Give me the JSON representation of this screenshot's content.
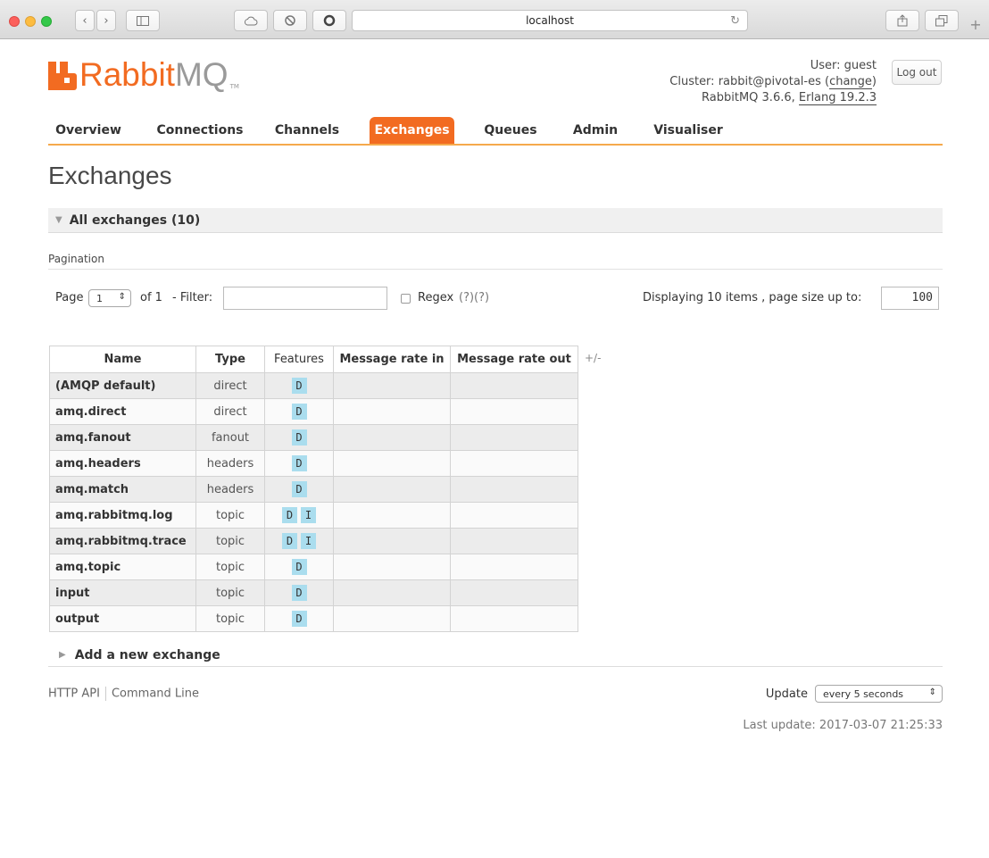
{
  "browser": {
    "address": "localhost",
    "reload_glyph": "↻",
    "newtab_glyph": "+"
  },
  "header": {
    "logo_rabbit": "Rabbit",
    "logo_mq": "MQ",
    "logo_tm": "TM",
    "user_line": "User: guest",
    "cluster_prefix": "Cluster: rabbit@pivotal-es (",
    "cluster_change": "change",
    "cluster_suffix": ")",
    "version_prefix": "RabbitMQ 3.6.6, ",
    "version_erlang": "Erlang 19.2.3",
    "logout_label": "Log out"
  },
  "nav": {
    "tabs": [
      {
        "label": "Overview"
      },
      {
        "label": "Connections"
      },
      {
        "label": "Channels"
      },
      {
        "label": "Exchanges"
      },
      {
        "label": "Queues"
      },
      {
        "label": "Admin"
      },
      {
        "label": "Visualiser"
      }
    ],
    "active": "Exchanges"
  },
  "main": {
    "title": "Exchanges",
    "section_title": "All exchanges (10)",
    "pagination_label": "Pagination",
    "page_label": "Page",
    "page_value": "1",
    "of_label": "of 1",
    "filter_label": "- Filter:",
    "filter_value": "",
    "regex_label": "Regex",
    "regex_help": "(?)(?)",
    "display_label": "Displaying 10 items , page size up to:",
    "page_size": "100",
    "columns_toggle": "+/-",
    "table": {
      "headers": [
        "Name",
        "Type",
        "Features",
        "Message rate in",
        "Message rate out"
      ],
      "rows": [
        {
          "name": "(AMQP default)",
          "type": "direct",
          "features": [
            "D"
          ],
          "rate_in": "",
          "rate_out": ""
        },
        {
          "name": "amq.direct",
          "type": "direct",
          "features": [
            "D"
          ],
          "rate_in": "",
          "rate_out": ""
        },
        {
          "name": "amq.fanout",
          "type": "fanout",
          "features": [
            "D"
          ],
          "rate_in": "",
          "rate_out": ""
        },
        {
          "name": "amq.headers",
          "type": "headers",
          "features": [
            "D"
          ],
          "rate_in": "",
          "rate_out": ""
        },
        {
          "name": "amq.match",
          "type": "headers",
          "features": [
            "D"
          ],
          "rate_in": "",
          "rate_out": ""
        },
        {
          "name": "amq.rabbitmq.log",
          "type": "topic",
          "features": [
            "D",
            "I"
          ],
          "rate_in": "",
          "rate_out": ""
        },
        {
          "name": "amq.rabbitmq.trace",
          "type": "topic",
          "features": [
            "D",
            "I"
          ],
          "rate_in": "",
          "rate_out": ""
        },
        {
          "name": "amq.topic",
          "type": "topic",
          "features": [
            "D"
          ],
          "rate_in": "",
          "rate_out": ""
        },
        {
          "name": "input",
          "type": "topic",
          "features": [
            "D"
          ],
          "rate_in": "",
          "rate_out": ""
        },
        {
          "name": "output",
          "type": "topic",
          "features": [
            "D"
          ],
          "rate_in": "",
          "rate_out": ""
        }
      ]
    },
    "add_exchange_label": "Add a new exchange"
  },
  "footer": {
    "http_api": "HTTP API",
    "command_line": "Command Line",
    "update_label": "Update",
    "update_value": "every 5 seconds",
    "last_update": "Last update: 2017-03-07 21:25:33"
  },
  "colors": {
    "brand_orange": "#f26b21",
    "badge_blue": "#aaddee"
  }
}
